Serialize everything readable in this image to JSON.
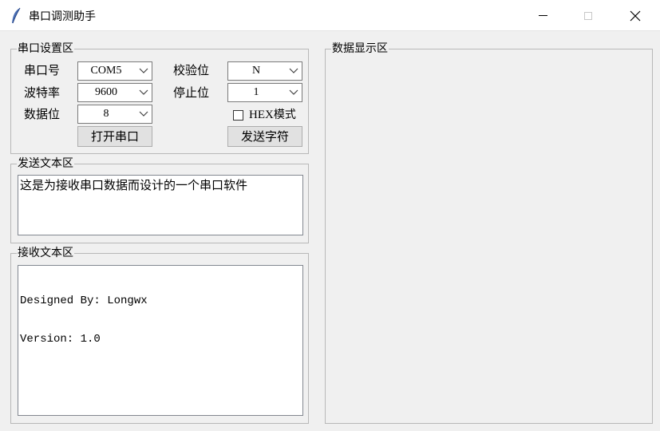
{
  "window": {
    "title": "串口调测助手"
  },
  "serial_settings": {
    "group_title": "串口设置区",
    "port_label": "串口号",
    "port_value": "COM5",
    "baud_label": "波特率",
    "baud_value": "9600",
    "data_bits_label": "数据位",
    "data_bits_value": "8",
    "parity_label": "校验位",
    "parity_value": "N",
    "stop_bits_label": "停止位",
    "stop_bits_value": "1",
    "hex_mode_prefix": "HEX",
    "hex_mode_suffix": "模式",
    "hex_mode_checked": false,
    "open_port_button": "打开串口",
    "send_button": "发送字符"
  },
  "send_area": {
    "group_title": "发送文本区",
    "text": "这是为接收串口数据而设计的一个串口软件"
  },
  "receive_area": {
    "group_title": "接收文本区",
    "lines": [
      "Designed By: Longwx",
      "Version: 1.0"
    ]
  },
  "data_display": {
    "group_title": "数据显示区"
  },
  "colors": {
    "background": "#f0f0f0",
    "titlebar": "#ffffff",
    "field": "#ffffff",
    "button": "#e1e1e1"
  }
}
